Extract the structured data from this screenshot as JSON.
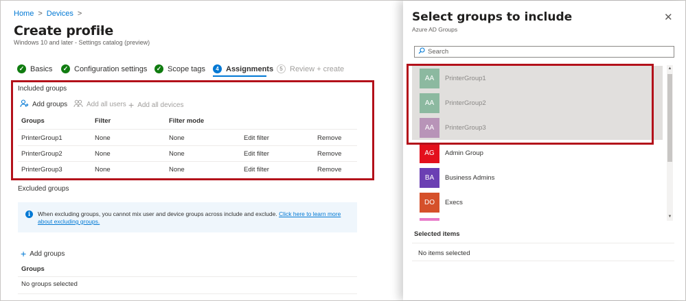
{
  "breadcrumb": {
    "home": "Home",
    "sep1": ">",
    "devices": "Devices",
    "sep2": ">"
  },
  "page": {
    "title": "Create profile",
    "more": "···",
    "subtitle": "Windows 10 and later - Settings catalog (preview)"
  },
  "steps": [
    {
      "label": "Basics",
      "state": "done",
      "mark": "✓"
    },
    {
      "label": "Configuration settings",
      "state": "done",
      "mark": "✓"
    },
    {
      "label": "Scope tags",
      "state": "done",
      "mark": "✓"
    },
    {
      "label": "Assignments",
      "state": "active",
      "mark": "4"
    },
    {
      "label": "Review + create",
      "state": "disabled",
      "mark": "5"
    }
  ],
  "included": {
    "label": "Included groups",
    "commands": [
      {
        "label": "Add groups",
        "icon": "add-user-icon",
        "enabled": true
      },
      {
        "label": "Add all users",
        "icon": "users-icon",
        "enabled": false
      },
      {
        "label": "Add all devices",
        "icon": "plus-icon",
        "enabled": false
      }
    ],
    "columns": [
      "Groups",
      "Filter",
      "Filter mode"
    ],
    "rows": [
      {
        "group": "PrinterGroup1",
        "filter": "None",
        "mode": "None",
        "edit": "Edit filter",
        "remove": "Remove"
      },
      {
        "group": "PrinterGroup2",
        "filter": "None",
        "mode": "None",
        "edit": "Edit filter",
        "remove": "Remove"
      },
      {
        "group": "PrinterGroup3",
        "filter": "None",
        "mode": "None",
        "edit": "Edit filter",
        "remove": "Remove"
      }
    ]
  },
  "excluded": {
    "label": "Excluded groups",
    "info_text": "When excluding groups, you cannot mix user and device groups across include and exclude.",
    "info_link": "Click here to learn more about excluding groups.",
    "add_label": "Add groups",
    "column": "Groups",
    "empty": "No groups selected"
  },
  "panel": {
    "title": "Select groups to include",
    "subtitle": "Azure AD Groups",
    "close": "✕",
    "search_placeholder": "Search",
    "groups": [
      {
        "initials": "AA",
        "name": "PrinterGroup1",
        "color": "#8cb9a0",
        "selected": true
      },
      {
        "initials": "AA",
        "name": "PrinterGroup2",
        "color": "#8cb9a0",
        "selected": true
      },
      {
        "initials": "AA",
        "name": "PrinterGroup3",
        "color": "#b894b8",
        "selected": true
      },
      {
        "initials": "AG",
        "name": "Admin Group",
        "color": "#e3101c",
        "selected": false
      },
      {
        "initials": "BA",
        "name": "Business Admins",
        "color": "#6b3fb3",
        "selected": false
      },
      {
        "initials": "DO",
        "name": "Execs",
        "color": "#d5502a",
        "selected": false
      }
    ],
    "selected_label": "Selected items",
    "selected_empty": "No items selected"
  },
  "colors": {
    "accent": "#0078d4",
    "highlight": "#b3101a",
    "success": "#107c10"
  }
}
